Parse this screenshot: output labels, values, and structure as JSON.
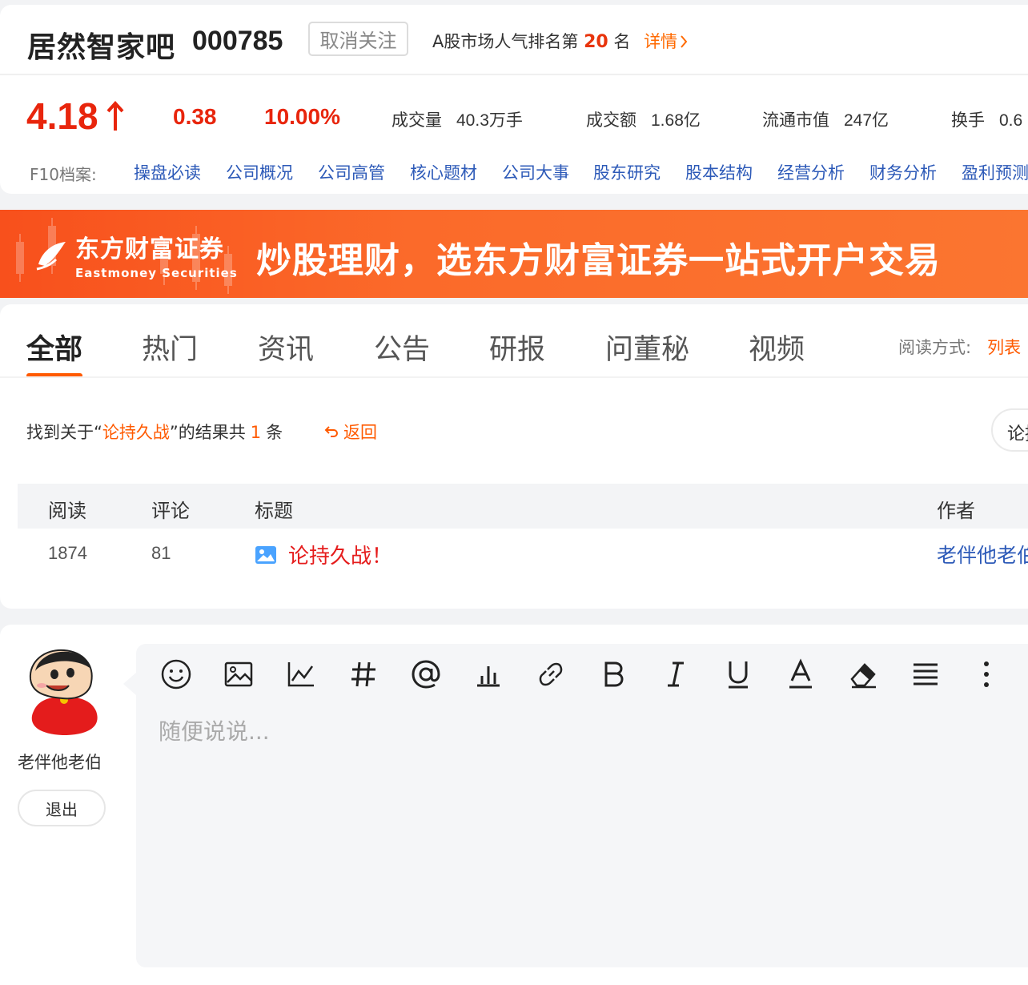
{
  "header": {
    "stock_name": "居然智家吧",
    "stock_code": "000785",
    "follow_button": "取消关注",
    "rank_prefix": "A股市场人气排名第",
    "rank_value": "20",
    "rank_suffix": "名",
    "rank_detail": "详情"
  },
  "quote": {
    "price": "4.18",
    "change": "0.38",
    "change_pct": "10.00%",
    "volume_label": "成交量",
    "volume_value": "40.3万手",
    "amount_label": "成交额",
    "amount_value": "1.68亿",
    "float_cap_label": "流通市值",
    "float_cap_value": "247亿",
    "turnover_label": "换手",
    "turnover_value": "0.6",
    "up_color": "#e8250c"
  },
  "f10": {
    "label": "F10档案:",
    "links": [
      "操盘必读",
      "公司概况",
      "公司高管",
      "核心题材",
      "公司大事",
      "股东研究",
      "股本结构",
      "经营分析",
      "财务分析",
      "盈利预测"
    ]
  },
  "banner": {
    "brand_cn": "东方财富证券",
    "brand_en": "Eastmoney Securities",
    "slogan": "炒股理财，选东方财富证券一站式开户交易"
  },
  "tabs": {
    "items": [
      "全部",
      "热门",
      "资讯",
      "公告",
      "研报",
      "问董秘",
      "视频"
    ],
    "active": "全部",
    "read_mode_label": "阅读方式:",
    "read_mode_option": "列表"
  },
  "search": {
    "prefix": "找到关于“",
    "keyword": "论持久战",
    "middle": "”的结果共",
    "count": "1",
    "suffix": "条",
    "back_label": "返回",
    "pill_text": "论持"
  },
  "table": {
    "headers": {
      "read": "阅读",
      "comment": "评论",
      "title": "标题",
      "author": "作者"
    },
    "rows": [
      {
        "read": "1874",
        "comment": "81",
        "title": "论持久战！",
        "author": "老伴他老伯"
      }
    ]
  },
  "editor": {
    "username": "老伴他老伯",
    "logout": "退出",
    "placeholder": "随便说说...",
    "tools": [
      "emoji-icon",
      "image-icon",
      "chart-icon",
      "hashtag-icon",
      "mention-icon",
      "poll-icon",
      "link-icon",
      "bold-icon",
      "italic-icon",
      "underline-icon",
      "font-color-icon",
      "eraser-icon",
      "align-icon",
      "more-icon"
    ]
  },
  "colors": {
    "accent": "#ff5a00",
    "link": "#2d5ab8",
    "red": "#e51c1c"
  }
}
